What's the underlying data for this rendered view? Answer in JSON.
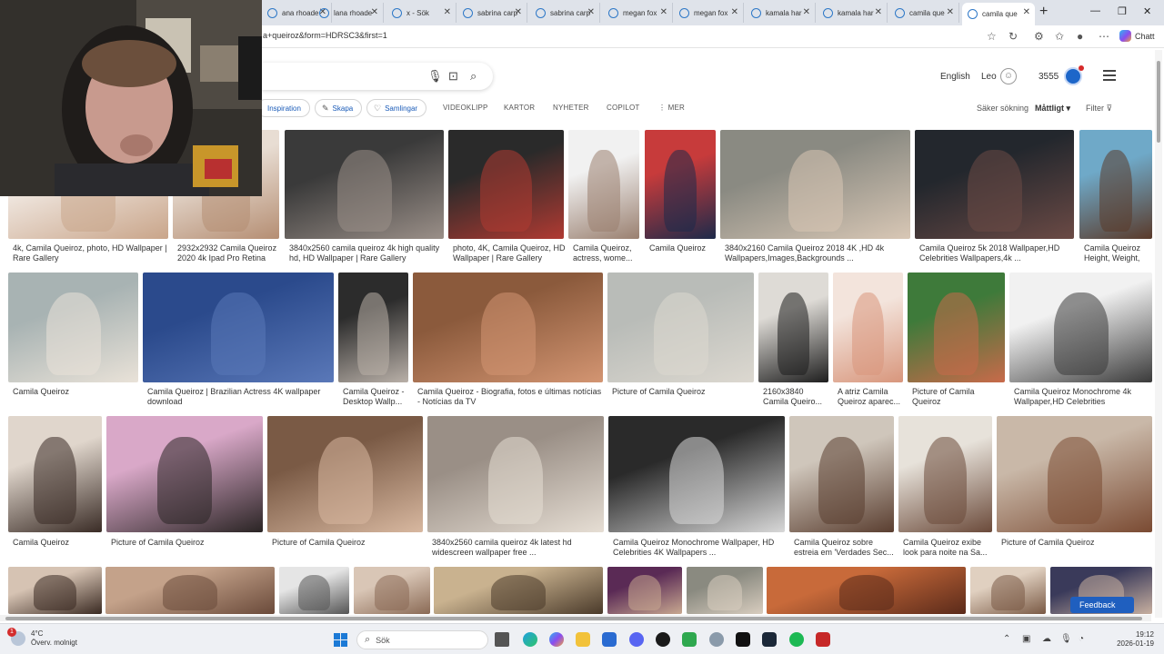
{
  "tabs": [
    {
      "title": "ana rhoade",
      "active": false
    },
    {
      "title": "lana rhoade",
      "active": false
    },
    {
      "title": "x - Sök",
      "active": false
    },
    {
      "title": "sabrina carp",
      "active": false
    },
    {
      "title": "sabrina carp",
      "active": false
    },
    {
      "title": "megan fox",
      "active": false
    },
    {
      "title": "megan fox",
      "active": false
    },
    {
      "title": "kamala har",
      "active": false
    },
    {
      "title": "kamala har",
      "active": false
    },
    {
      "title": "camila que",
      "active": false
    },
    {
      "title": "camila que",
      "active": true
    }
  ],
  "browser": {
    "new_tab": "+",
    "url": "a+queiroz&form=HDRSC3&first=1",
    "copilot_label": "Chatt",
    "window_controls": [
      "—",
      "❐",
      "✕"
    ]
  },
  "header": {
    "language": "English",
    "user": "Leo",
    "points": "3555"
  },
  "chips": [
    {
      "label": "Inspiration",
      "icon": "lightbulb-icon",
      "glyph": ""
    },
    {
      "label": "Skapa",
      "icon": "create-icon",
      "glyph": "✎"
    },
    {
      "label": "Samlingar",
      "icon": "collections-icon",
      "glyph": "♡"
    }
  ],
  "nav": [
    "VIDEOKLIPP",
    "KARTOR",
    "NYHETER",
    "COPILOT",
    "⋮ MER"
  ],
  "filters": {
    "safe_search_label": "Säker sökning",
    "safe_search_value": "Måttligt ▾",
    "filter_label": "Filter ⊽"
  },
  "images": [
    {
      "caption": "4k, Camila Queiroz, photo, HD Wallpaper | Rare Gallery",
      "colors": [
        "#f2ebe5",
        "#c9a58a"
      ]
    },
    {
      "caption": "2932x2932 Camila Queiroz 2020 4k Ipad Pro Retina D...",
      "colors": [
        "#e8ddd3",
        "#b58e73"
      ]
    },
    {
      "caption": "3840x2560 camila queiroz 4k high quality hd, HD Wallpaper | Rare Gallery",
      "colors": [
        "#3a3a3a",
        "#9a8f88"
      ]
    },
    {
      "caption": "photo, 4K, Camila Queiroz, HD Wallpaper | Rare Gallery",
      "colors": [
        "#2a2a2a",
        "#b03a32"
      ]
    },
    {
      "caption": "Camila Queiroz, actress, wome...",
      "colors": [
        "#f1f1f1",
        "#9a8070"
      ]
    },
    {
      "caption": "Camila Queiroz",
      "colors": [
        "#c73b3b",
        "#1d2a4a"
      ]
    },
    {
      "caption": "3840x2160 Camila Queiroz 2018 4K ,HD 4k Wallpapers,Images,Backgrounds ...",
      "colors": [
        "#8a8a82",
        "#d8c7b5"
      ]
    },
    {
      "caption": "Camila Queiroz 5k 2018 Wallpaper,HD Celebrities Wallpapers,4k ...",
      "colors": [
        "#23272d",
        "#6b4a45"
      ]
    },
    {
      "caption": "Camila Queiroz Height, Weight, A...",
      "colors": [
        "#6fa9c8",
        "#5a3a2a"
      ]
    },
    {
      "caption": "Camila Queiroz",
      "colors": [
        "#a8b3b3",
        "#e9e2d8"
      ]
    },
    {
      "caption": "Camila Queiroz | Brazilian Actress 4K wallpaper download",
      "colors": [
        "#2b4a8c",
        "#5a78b8"
      ]
    },
    {
      "caption": "Camila Queiroz - Desktop Wallp...",
      "colors": [
        "#2c2c2c",
        "#b9b0a8"
      ]
    },
    {
      "caption": "Camila Queiroz - Biografia, fotos e últimas notícias - Notícias da TV",
      "colors": [
        "#8b5a3c",
        "#d39572"
      ]
    },
    {
      "caption": "Picture of Camila Queiroz",
      "colors": [
        "#b9bcb8",
        "#dcd8d0"
      ]
    },
    {
      "caption": "2160x3840 Camila Queiro...",
      "colors": [
        "#dedbd6",
        "#1e1e1e"
      ]
    },
    {
      "caption": "A atriz Camila Queiroz aparec...",
      "colors": [
        "#f3e4dc",
        "#d8967c"
      ]
    },
    {
      "caption": "Picture of Camila Queiroz",
      "colors": [
        "#3e7a3a",
        "#c86a4a"
      ]
    },
    {
      "caption": "Camila Queiroz Monochrome 4k Wallpaper,HD Celebrities Wallpapers,...",
      "colors": [
        "#f1f1f1",
        "#3a3a3a"
      ]
    },
    {
      "caption": "Camila Queiroz",
      "colors": [
        "#e0d6cc",
        "#3a2c26"
      ]
    },
    {
      "caption": "Picture of Camila Queiroz",
      "colors": [
        "#d9a8c8",
        "#2a2424"
      ]
    },
    {
      "caption": "Picture of Camila Queiroz",
      "colors": [
        "#7a5a45",
        "#d8b8a0"
      ]
    },
    {
      "caption": "3840x2560 camila queiroz 4k latest hd widescreen wallpaper free ...",
      "colors": [
        "#9a8f86",
        "#e6ded4"
      ]
    },
    {
      "caption": "Camila Queiroz Monochrome Wallpaper, HD Celebrities 4K Wallpapers ...",
      "colors": [
        "#2a2a2a",
        "#d8d8d8"
      ]
    },
    {
      "caption": "Camila Queiroz sobre estreia em 'Verdades Sec...",
      "colors": [
        "#cfc6bb",
        "#5a3e30"
      ]
    },
    {
      "caption": "Camila Queiroz exibe look para noite na Sa...",
      "colors": [
        "#e7e2da",
        "#6b4a3a"
      ]
    },
    {
      "caption": "Picture of Camila Queiroz",
      "colors": [
        "#c9b8a8",
        "#7a4a32"
      ]
    },
    {
      "caption": "",
      "colors": [
        "#d6c3b3",
        "#3a2a22"
      ]
    },
    {
      "caption": "",
      "colors": [
        "#c4a28a",
        "#6a4a3a"
      ]
    },
    {
      "caption": "",
      "colors": [
        "#e5e5e5",
        "#555555"
      ]
    },
    {
      "caption": "",
      "colors": [
        "#d9c6b6",
        "#8a6a55"
      ]
    },
    {
      "caption": "",
      "colors": [
        "#c9b28f",
        "#4a3a2a"
      ]
    },
    {
      "caption": "",
      "colors": [
        "#5a2a55",
        "#c8a890"
      ]
    },
    {
      "caption": "",
      "colors": [
        "#8a8a80",
        "#d8cdbf"
      ]
    },
    {
      "caption": "",
      "colors": [
        "#c86a3a",
        "#5a2a1a"
      ]
    },
    {
      "caption": "",
      "colors": [
        "#e0d0c0",
        "#7a5a45"
      ]
    },
    {
      "caption": "",
      "colors": [
        "#3a3a5a",
        "#c8b0a0"
      ]
    }
  ],
  "feedback_label": "Feedback",
  "taskbar": {
    "weather_temp": "4°C",
    "weather_desc": "Överv. molnigt",
    "search_placeholder": "Sök",
    "time": "19:12",
    "date": "2026-01-19"
  },
  "colors": {
    "accent": "#1a5bb8",
    "rewards": "#1d66c9",
    "feedback": "#1f5fbf"
  }
}
